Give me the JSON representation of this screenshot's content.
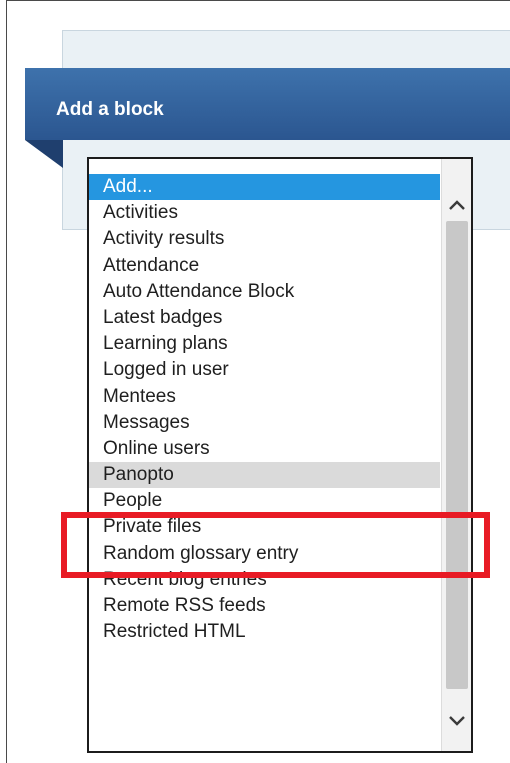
{
  "block": {
    "title": "Add a block"
  },
  "dropdown": {
    "options": [
      "Add...",
      "Activities",
      "Activity results",
      "Attendance",
      "Auto Attendance Block",
      "Latest badges",
      "Learning plans",
      "Logged in user",
      "Mentees",
      "Messages",
      "Online users",
      "Panopto",
      "People",
      "Private files",
      "Random glossary entry",
      "Recent blog entries",
      "Remote RSS feeds",
      "Restricted HTML"
    ],
    "selected": "Add...",
    "hovered": "Panopto"
  },
  "icons": {
    "scroll_up": "chevron-up-icon",
    "scroll_down": "chevron-down-icon"
  },
  "colors": {
    "header_bg": "#3567a1",
    "selected_bg": "#2596e0",
    "hover_bg": "#dadada",
    "annotation": "#e81b25"
  }
}
